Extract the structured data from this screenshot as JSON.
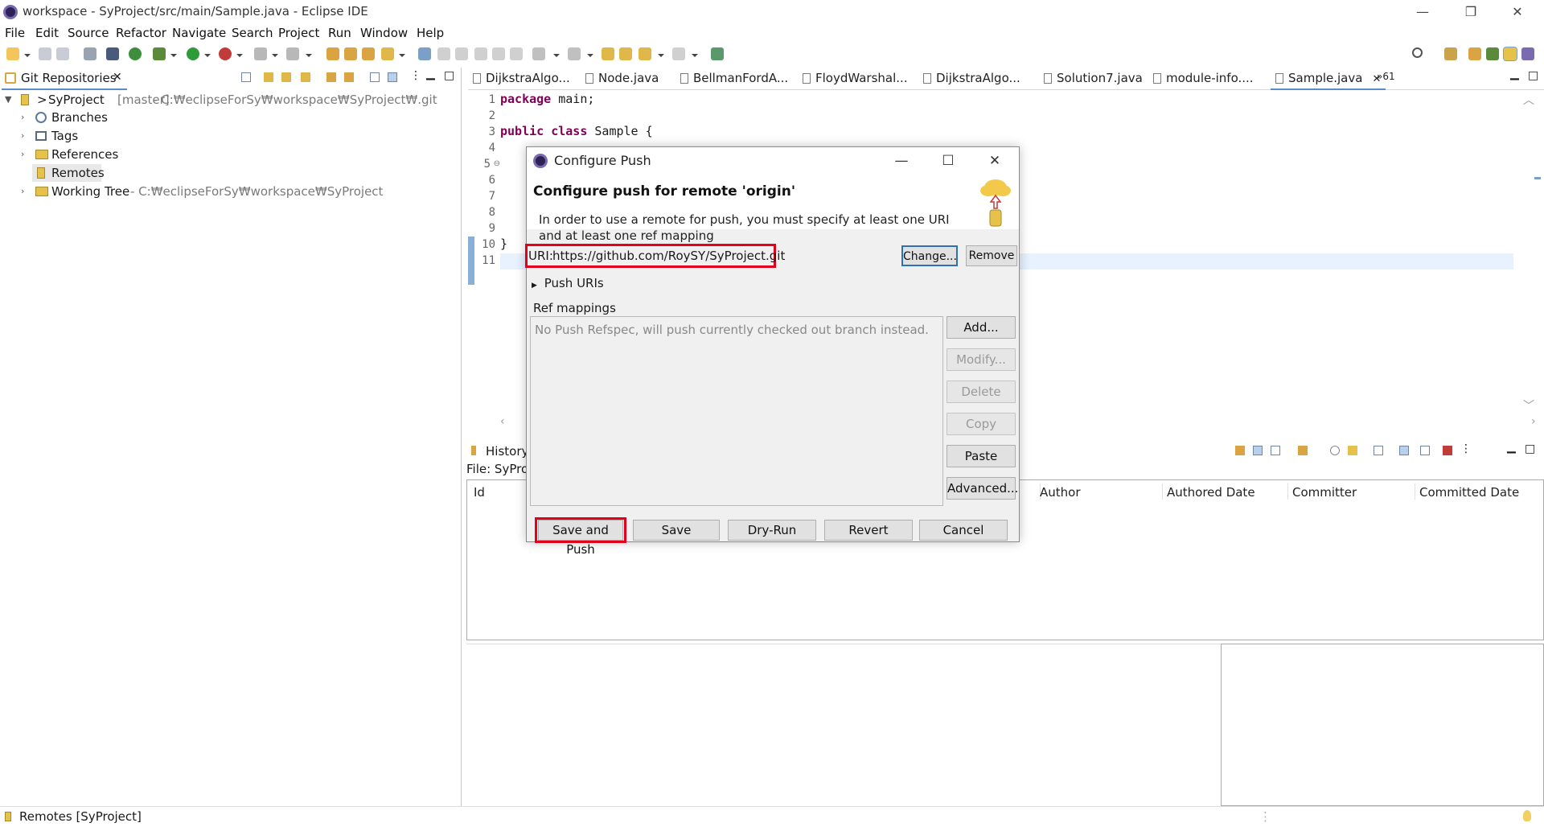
{
  "window": {
    "title": "workspace - SyProject/src/main/Sample.java - Eclipse IDE",
    "minimize": "—",
    "restore": "❐",
    "close": "✕"
  },
  "menu": [
    "File",
    "Edit",
    "Source",
    "Refactor",
    "Navigate",
    "Search",
    "Project",
    "Run",
    "Window",
    "Help"
  ],
  "git_repositories": {
    "tab_label": "Git Repositories",
    "repo_name": "SyProject",
    "repo_branch": "[master]",
    "repo_path": "- C:₩eclipseForSy₩workspace₩SyProject₩.git",
    "items": [
      {
        "label": "Branches"
      },
      {
        "label": "Tags"
      },
      {
        "label": "References"
      },
      {
        "label": "Remotes"
      }
    ],
    "working_tree_label": "Working Tree",
    "working_tree_path": "- C:₩eclipseForSy₩workspace₩SyProject"
  },
  "editor": {
    "tabs": [
      "DijkstraAlgo...",
      "Node.java",
      "BellmanFordA...",
      "FloydWarshal...",
      "DijkstraAlgo...",
      "Solution7.java",
      "module-info....",
      "Sample.java"
    ],
    "overflow": "»61",
    "line_numbers": [
      "1",
      "2",
      "3",
      "4",
      "5",
      "6",
      "7",
      "8",
      "9",
      "10",
      "11"
    ],
    "code": {
      "l1_kw": "package",
      "l1_rest": " main;",
      "l3_kw1": "public",
      "l3_kw2": "class",
      "l3_rest": " Sample {",
      "l10": "}"
    }
  },
  "history": {
    "tab_label": "History",
    "file_label": "File: SyProj",
    "columns": [
      "Id",
      "Author",
      "Authored Date",
      "Committer",
      "Committed Date"
    ]
  },
  "status_bar": {
    "text": "Remotes [SyProject]"
  },
  "dialog": {
    "title": "Configure Push",
    "heading": "Configure push for remote 'origin'",
    "description": "In order to use a remote for push, you must specify at least one URI and at least one ref mapping",
    "uri_label": "URI:",
    "uri_value": "https://github.com/RoySY/SyProject.git",
    "change_button": "Change...",
    "remove_button": "Remove",
    "push_uris_label": "Push URIs",
    "ref_mappings_label": "Ref mappings",
    "ref_mappings_empty": "No Push Refspec, will push currently checked out branch instead.",
    "side_buttons": {
      "add": "Add...",
      "modify": "Modify...",
      "delete": "Delete",
      "copy": "Copy",
      "paste": "Paste",
      "advanced": "Advanced..."
    },
    "footer_buttons": {
      "save_and_push": "Save and Push",
      "save": "Save",
      "dry_run": "Dry-Run",
      "revert": "Revert",
      "cancel": "Cancel"
    }
  },
  "colors": {
    "highlight": "#e2001a",
    "keyword": "#7f0055",
    "current_line": "#e8f2fe",
    "accent": "#5d8ac9"
  }
}
